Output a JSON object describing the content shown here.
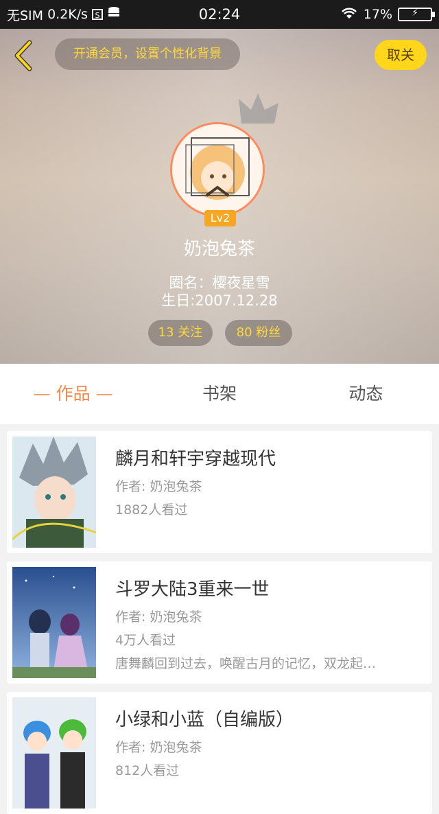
{
  "status_bar": {
    "carrier": "无SIM",
    "speed": "0.2K/s",
    "s_icon_label": "S",
    "time": "02:24",
    "battery": "17%"
  },
  "header": {
    "banner": "开通会员，设置个性化背景",
    "follow_label": "取关",
    "level": "Lv2",
    "nickname": "奶泡兔茶",
    "circle_name": "圈名：樱夜星雪",
    "birthday": "生日:2007.12.28",
    "following": "13 关注",
    "fans": "80 粉丝",
    "colors": {
      "accent": "#ffd61a",
      "avatar_border": "#ff8a5c"
    }
  },
  "tabs": [
    {
      "label": "— 作品 —",
      "active": true
    },
    {
      "label": "书架",
      "active": false
    },
    {
      "label": "动态",
      "active": false
    }
  ],
  "works": [
    {
      "title": "麟月和轩宇穿越现代",
      "author": "作者: 奶泡兔茶",
      "views": "1882人看过",
      "desc": ""
    },
    {
      "title": "斗罗大陆3重来一世",
      "author": "作者: 奶泡兔茶",
      "views": "4万人看过",
      "desc": "唐舞麟回到过去，唤醒古月的记忆，双龙起…"
    },
    {
      "title": "小绿和小蓝（自编版）",
      "author": "作者: 奶泡兔茶",
      "views": "812人看过",
      "desc": ""
    }
  ]
}
